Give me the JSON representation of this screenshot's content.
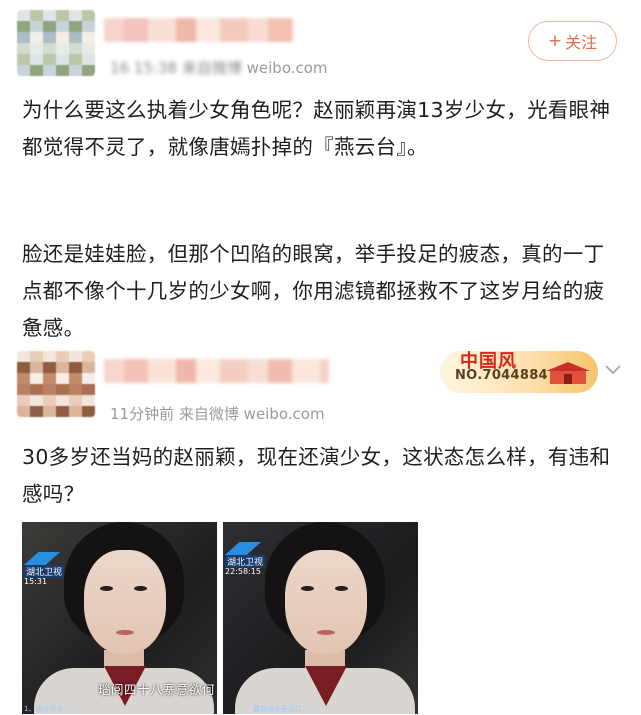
{
  "post1": {
    "meta_blurred": "16 15:38 来自微博",
    "meta_site": "weibo.com",
    "follow_plus": "+",
    "follow_label": "关注",
    "para1": "为什么要这么执着少女角色呢？赵丽颖再演13岁少女，光看眼神都觉得不灵了，就像唐嫣扑掉的『燕云台』。",
    "para2": "脸还是娃娃脸，但那个凹陷的眼窝，举手投足的疲态，真的一丁点都不像个十几岁的少女啊，你用滤镜都拯救不了这岁月给的疲惫感。"
  },
  "post2": {
    "meta": "11分钟前",
    "meta_source": "来自微博",
    "meta_site": "weibo.com",
    "badge_title": "中国风",
    "badge_number": "NO.7044884",
    "text": "30多岁还当妈的赵丽颖，现在还演少女，这状态怎么样，有违和感吗？",
    "images": [
      {
        "channel": "湖北卫视",
        "time": "15:31",
        "subtitle": "瑙阅四十八寨意欲何",
        "caption": "1、请分享与"
      },
      {
        "channel": "湖北卫视",
        "time": "22:58:15",
        "subtitle": "",
        "caption": "要封闭安全出口，"
      }
    ]
  },
  "colors": {
    "accent_orange": "#e86d4b",
    "meta_gray": "#9b9b9b",
    "text": "#1f1f1f"
  }
}
